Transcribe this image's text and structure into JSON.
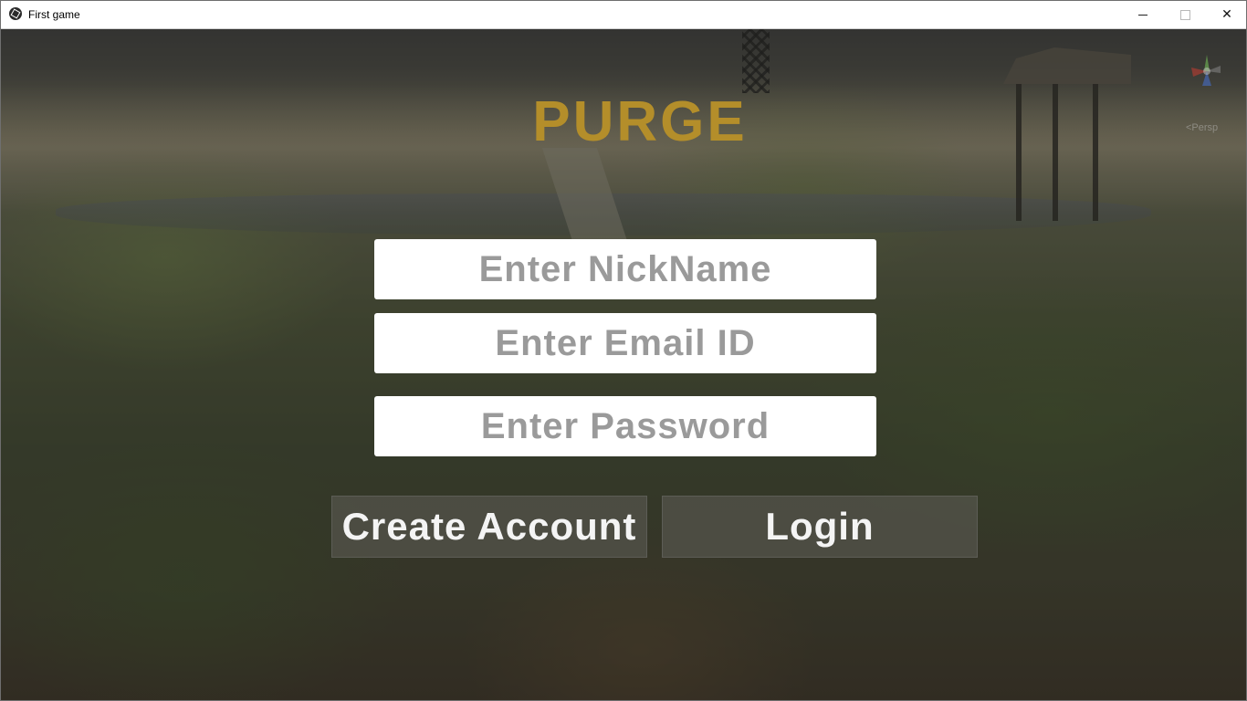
{
  "window": {
    "title": "First game",
    "minimize_icon": "minimize-icon",
    "maximize_icon": "maximize-icon",
    "close_icon": "close-icon",
    "close_glyph": "✕"
  },
  "scene": {
    "gizmo_label": "<Persp"
  },
  "login": {
    "game_title": "PURGE",
    "title_color": "#b48e2a",
    "nickname_placeholder": "Enter NickName",
    "email_placeholder": "Enter Email ID",
    "password_placeholder": "Enter Password",
    "create_account_label": "Create Account",
    "login_label": "Login"
  }
}
